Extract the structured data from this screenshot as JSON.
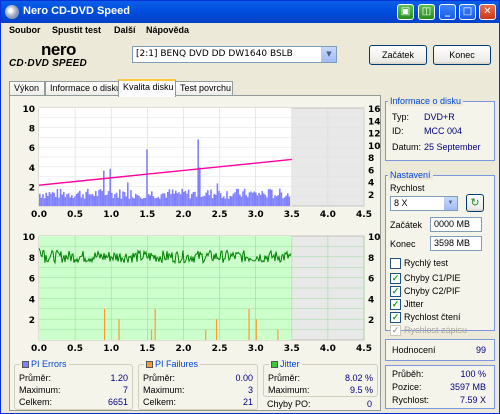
{
  "window": {
    "title": "Nero CD-DVD Speed"
  },
  "menu": [
    "Soubor",
    "Spustit test",
    "Další",
    "Nápověda"
  ],
  "logo": {
    "line1": "nero",
    "line2": "CD·DVD SPEED"
  },
  "drive_select": {
    "value": "[2:1]   BENQ DVD DD DW1640 BSLB"
  },
  "buttons": {
    "start": "Začátek",
    "end": "Konec"
  },
  "tabs": [
    "Výkon",
    "Informace o disku",
    "Kvalita disku",
    "Test povrchu"
  ],
  "active_tab": 2,
  "disc_info": {
    "header": "Informace o disku",
    "rows": [
      {
        "k": "Typ:",
        "v": "DVD+R"
      },
      {
        "k": "ID:",
        "v": "MCC 004"
      },
      {
        "k": "Datum:",
        "v": "25 September"
      }
    ]
  },
  "settings": {
    "header": "Nastavení",
    "speed_label": "Rychlost",
    "speed_value": "8 X",
    "start_label": "Začátek",
    "start_value": "0000 MB",
    "end_label": "Konec",
    "end_value": "3598 MB",
    "checks": [
      {
        "label": "Rychlý test",
        "checked": false,
        "disabled": false
      },
      {
        "label": "Chyby C1/PIE",
        "checked": true,
        "disabled": false
      },
      {
        "label": "Chyby C2/PIF",
        "checked": true,
        "disabled": false
      },
      {
        "label": "Jitter",
        "checked": true,
        "disabled": false
      },
      {
        "label": "Rychlost čtení",
        "checked": true,
        "disabled": false
      },
      {
        "label": "Rychlost zápisu",
        "checked": true,
        "disabled": true
      }
    ]
  },
  "rating": {
    "label": "Hodnocení",
    "value": "99"
  },
  "progress": [
    {
      "k": "Průběh:",
      "v": "100 %"
    },
    {
      "k": "Pozice:",
      "v": "3597 MB"
    },
    {
      "k": "Rychlost:",
      "v": "7.59 X"
    }
  ],
  "stats": {
    "pi_errors": {
      "title": "PI Errors",
      "color": "#8080ff",
      "rows": [
        {
          "k": "Průměr:",
          "v": "1.20"
        },
        {
          "k": "Maximum:",
          "v": "7"
        },
        {
          "k": "Celkem:",
          "v": "6651"
        }
      ]
    },
    "pi_failures": {
      "title": "PI Failures",
      "color": "#ff9933",
      "rows": [
        {
          "k": "Průměr:",
          "v": "0.00"
        },
        {
          "k": "Maximum:",
          "v": "3"
        },
        {
          "k": "Celkem:",
          "v": "21"
        }
      ]
    },
    "jitter": {
      "title": "Jitter",
      "color": "#33cc33",
      "rows": [
        {
          "k": "Průměr:",
          "v": "8.02 %"
        },
        {
          "k": "Maximum:",
          "v": "9.5 %"
        }
      ]
    },
    "chyby_po": {
      "k": "Chyby PO:",
      "v": "0"
    }
  },
  "chart_data": [
    {
      "type": "bar",
      "title": "",
      "x_ticks": [
        "0.0",
        "0.5",
        "1.0",
        "1.5",
        "2.0",
        "2.5",
        "3.0",
        "3.5",
        "4.0",
        "4.5"
      ],
      "y_ticks_left": [
        "10",
        "8",
        "6",
        "4",
        "2"
      ],
      "y_ticks_right": [
        "16",
        "14",
        "12",
        "10",
        "8",
        "6",
        "4",
        "2"
      ],
      "xlim": [
        0,
        4.5
      ],
      "ylim_left": [
        0,
        10
      ],
      "ylim_right": [
        0,
        16
      ],
      "series": [
        {
          "name": "PI Errors",
          "color": "#8080ff",
          "avg": 1.2,
          "max": 7,
          "x_end": 3.5
        },
        {
          "name": "Read Speed",
          "color": "#ff00a0",
          "x": [
            0,
            3.5
          ],
          "y": [
            3.4,
            7.6
          ]
        }
      ]
    },
    {
      "type": "line",
      "title": "",
      "x_ticks": [
        "0.0",
        "0.5",
        "1.0",
        "1.5",
        "2.0",
        "2.5",
        "3.0",
        "3.5",
        "4.0",
        "4.5"
      ],
      "y_ticks_left": [
        "10",
        "8",
        "6",
        "4",
        "2"
      ],
      "y_ticks_right": [
        "10",
        "8",
        "6",
        "4",
        "2"
      ],
      "xlim": [
        0,
        4.5
      ],
      "ylim_left": [
        0,
        10
      ],
      "ylim_right": [
        0,
        10
      ],
      "series": [
        {
          "name": "Jitter",
          "color": "#008000",
          "avg": 8.02,
          "max": 9.5,
          "x_end": 3.5
        },
        {
          "name": "PI Failures",
          "color": "#ff9933",
          "max": 3,
          "x_end": 3.5
        }
      ]
    }
  ]
}
